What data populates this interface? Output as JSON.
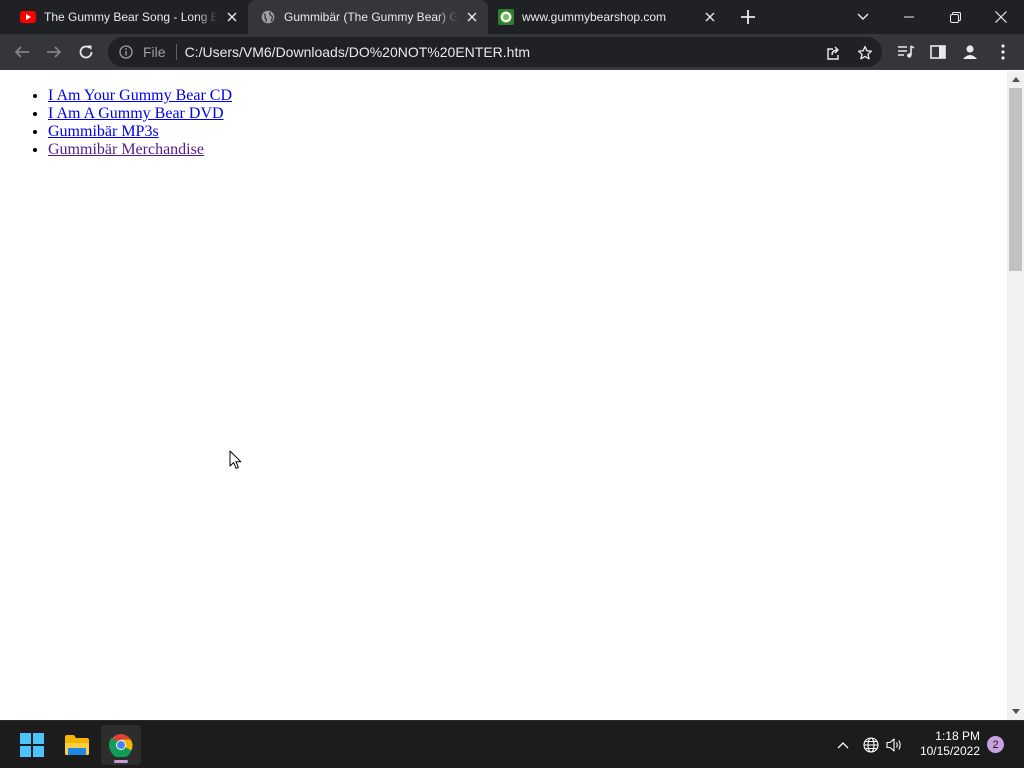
{
  "browser": {
    "tabs": [
      {
        "title": "The Gummy Bear Song - Long English Version",
        "favicon": "youtube-icon",
        "active": false
      },
      {
        "title": "Gummibär (The Gummy Bear) Gallery",
        "favicon": "globe-icon",
        "active": true
      },
      {
        "title": "www.gummybearshop.com",
        "favicon": "gummybear-shop-icon",
        "active": false
      }
    ],
    "address": {
      "scheme_label": "File",
      "url": "C:/Users/VM6/Downloads/DO%20NOT%20ENTER.htm"
    }
  },
  "page": {
    "links": [
      {
        "label": "I Am Your Gummy Bear CD",
        "visited": false
      },
      {
        "label": "I Am A Gummy Bear DVD",
        "visited": false
      },
      {
        "label": "Gummibär MP3s",
        "visited": false
      },
      {
        "label": "Gummibär Merchandise",
        "visited": true
      }
    ]
  },
  "taskbar": {
    "apps": [
      "windows-start-icon",
      "file-explorer-icon",
      "chrome-icon"
    ],
    "clock": {
      "time": "1:18 PM",
      "date": "10/15/2022"
    },
    "notification_count": "2"
  },
  "colors": {
    "tabstrip": "#202124",
    "toolbar": "#35363a",
    "omnibox": "#202124",
    "link": "#0000ee",
    "visited_link": "#551a8b",
    "taskbar": "#1c1c1c",
    "youtube_red": "#ff0000",
    "windows_blue": "#4cc2ff"
  }
}
